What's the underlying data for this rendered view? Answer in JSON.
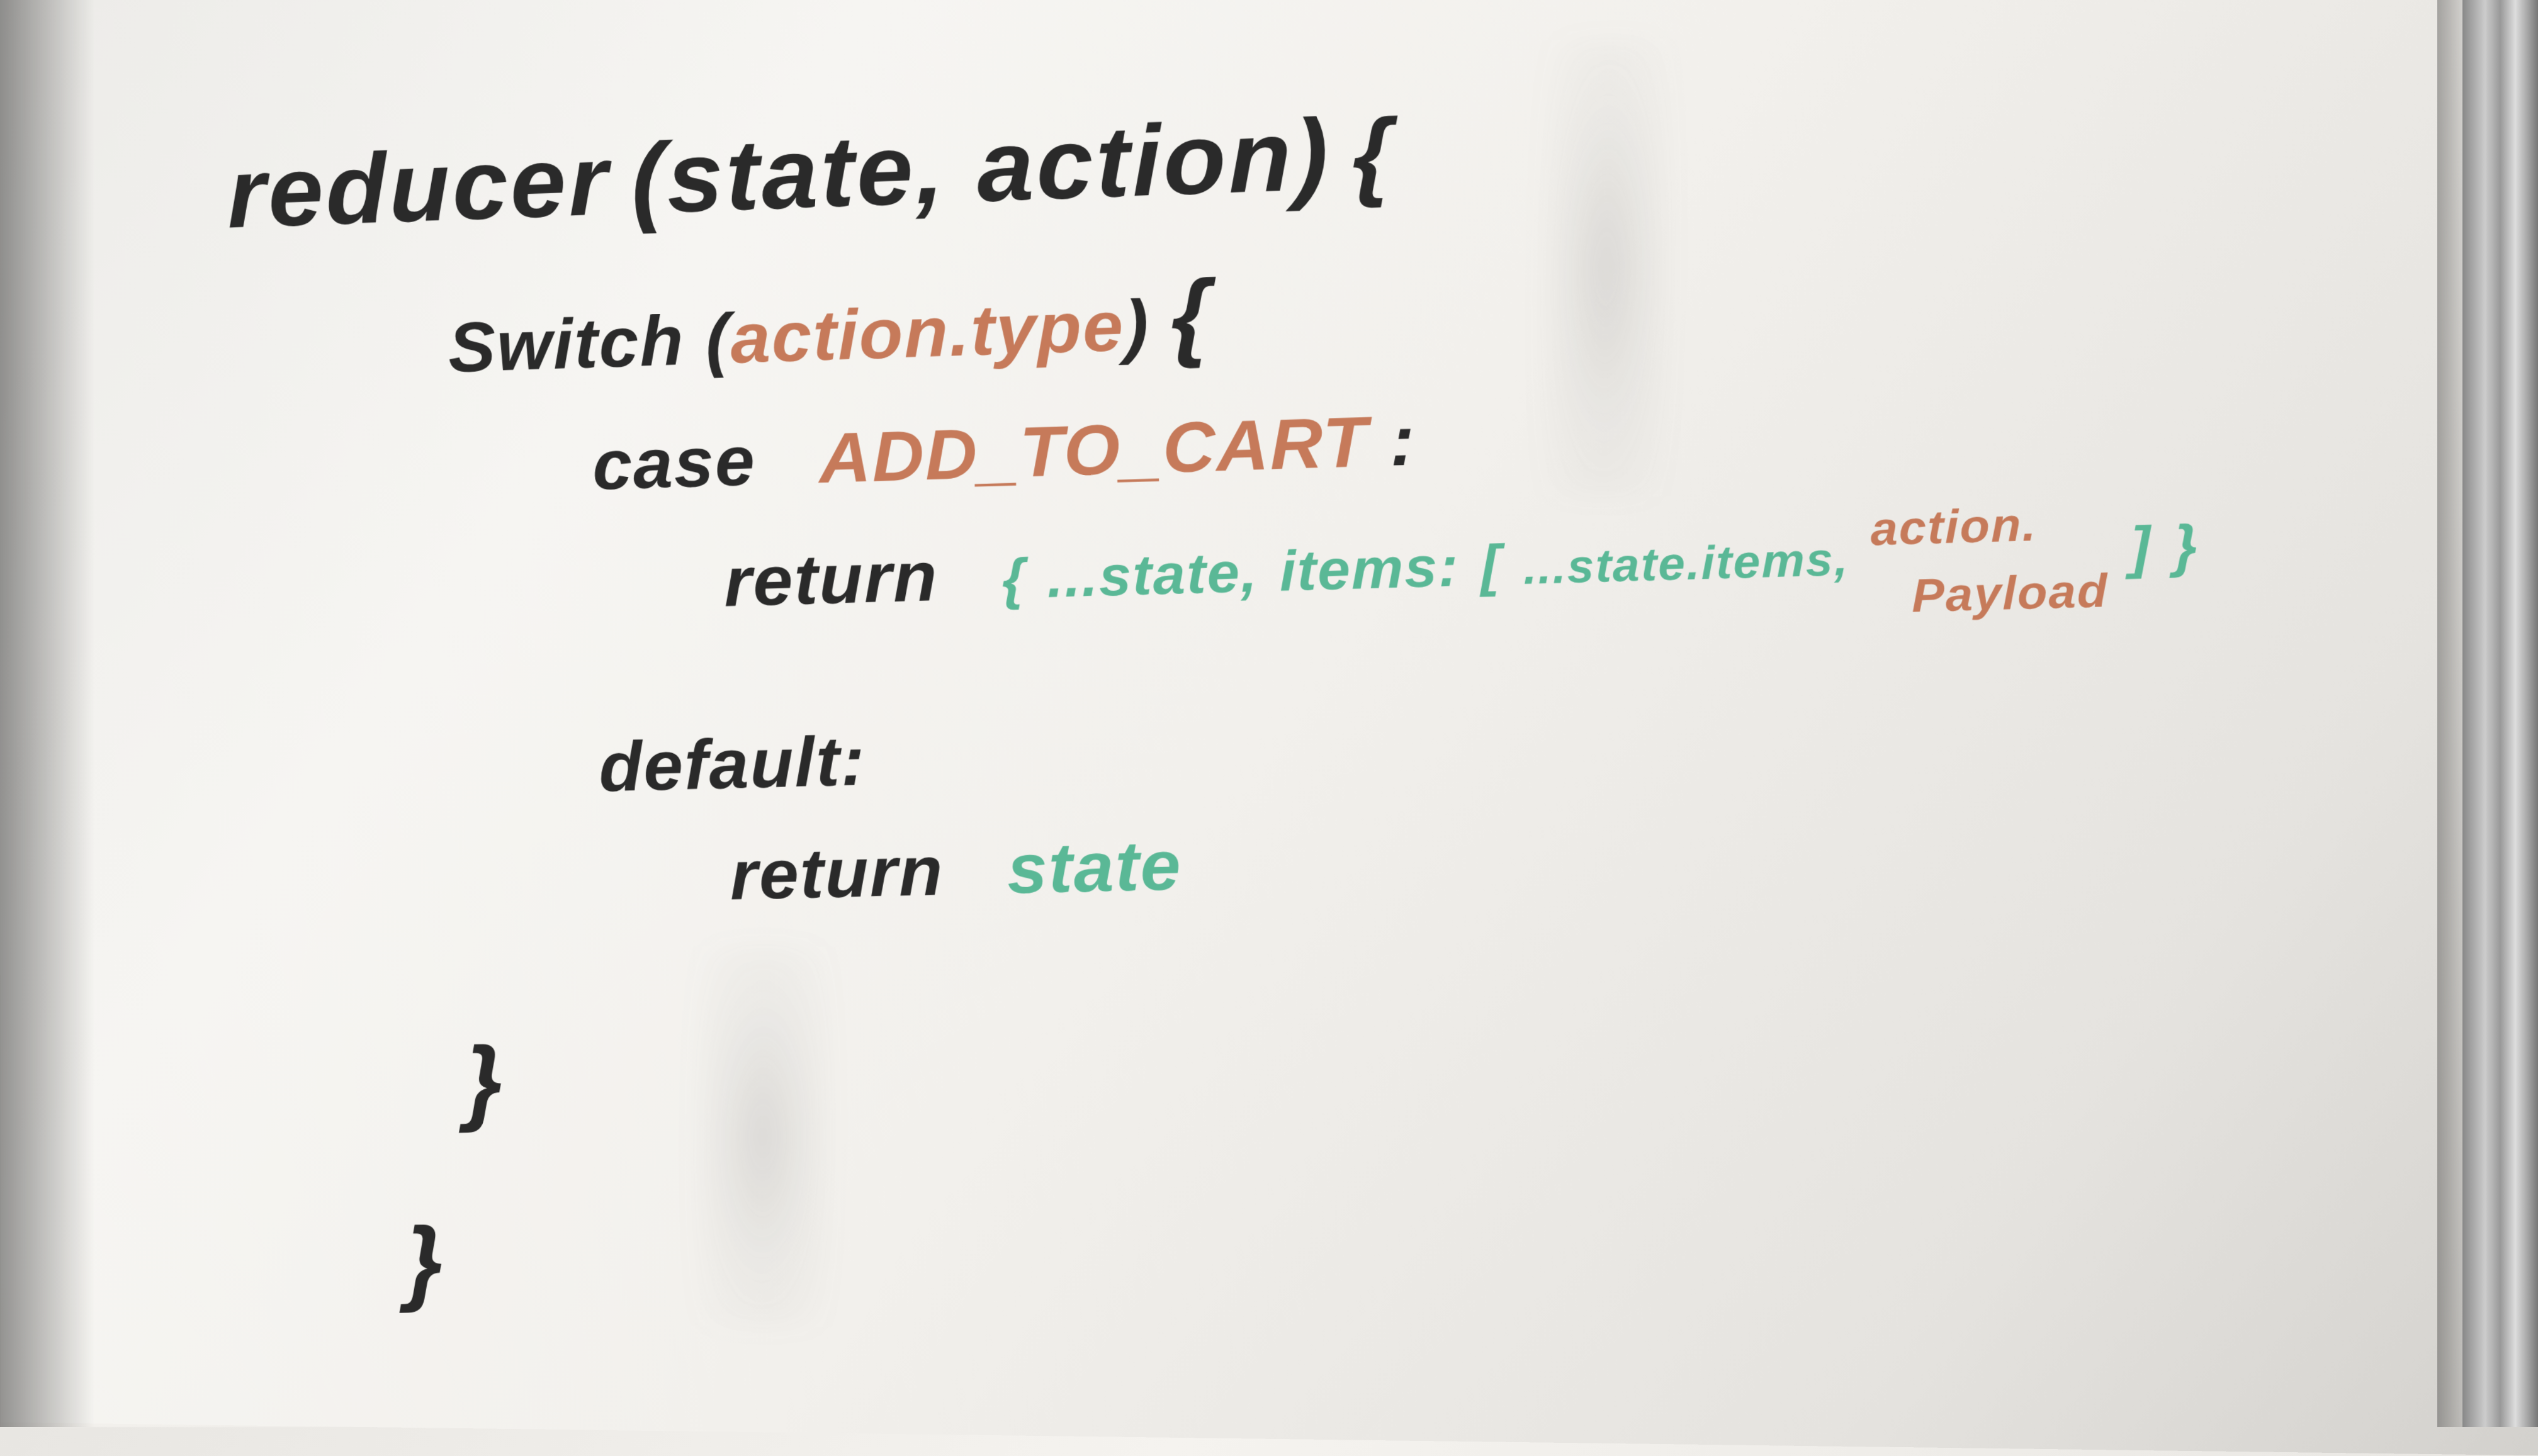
{
  "code": {
    "line1": {
      "reducer": "reducer",
      "params": "(state, action)",
      "brace": "{"
    },
    "line2": {
      "switch_kw": "Switch",
      "open_paren": "(",
      "action_type": "action.type",
      "close_paren": ")",
      "brace": "{"
    },
    "line3": {
      "case_kw": "case",
      "case_val": "ADD_TO_CART",
      "colon": ":"
    },
    "line4": {
      "return_kw": "return",
      "obj_open": "{",
      "spread_state": "...state,",
      "items_key": "items:",
      "arr_open": "[",
      "spread_items": "...state.items,",
      "action_word": "action.",
      "payload_word": "Payload",
      "arr_close": "]",
      "obj_close": "}"
    },
    "line5": {
      "default_kw": "default",
      "colon": ":"
    },
    "line6": {
      "return_kw": "return",
      "state_val": "state"
    },
    "line7": {
      "brace": "}"
    },
    "line8": {
      "brace": "}"
    }
  }
}
